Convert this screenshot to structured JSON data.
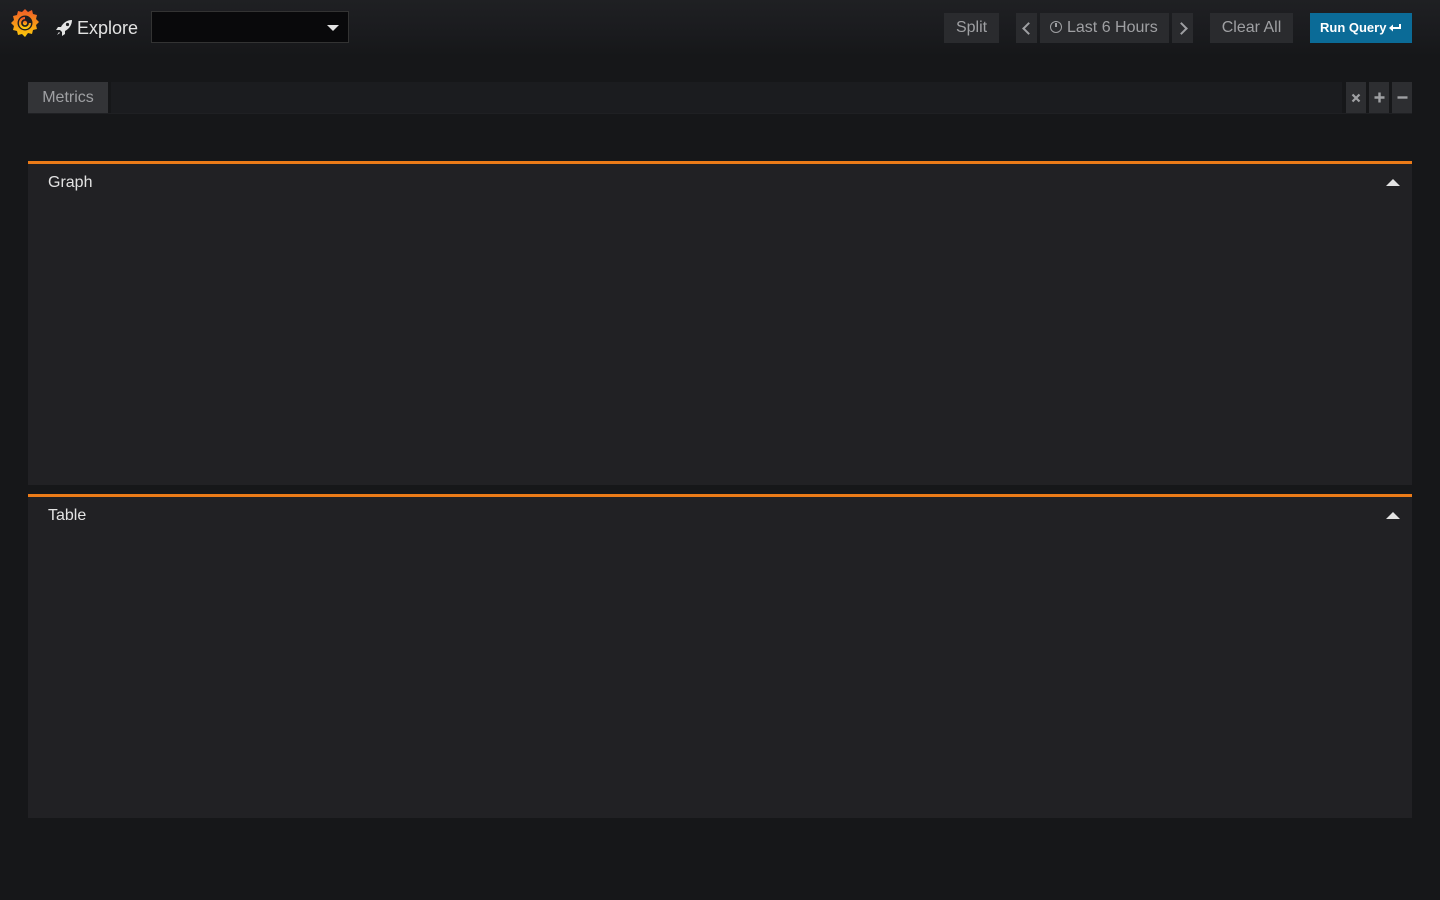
{
  "navbar": {
    "logo_icon": "grafana-logo-icon",
    "explore_icon": "rocket-icon",
    "title": "Explore",
    "datasource_value": "",
    "split_label": "Split",
    "time_range_label": "Last 6 Hours",
    "clear_all_label": "Clear All",
    "run_query_label": "Run Query"
  },
  "query": {
    "label": "Metrics",
    "value": "",
    "placeholder": ""
  },
  "panels": [
    {
      "title": "Graph"
    },
    {
      "title": "Table"
    }
  ],
  "colors": {
    "accent": "#eb7b18",
    "primary_button": "#0b6b97",
    "background": "#161719",
    "panel": "#212124"
  }
}
